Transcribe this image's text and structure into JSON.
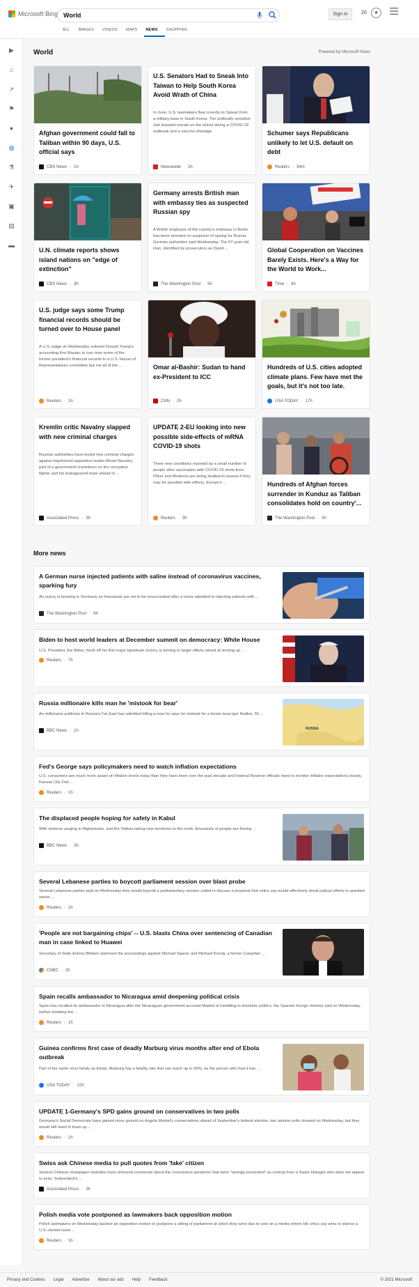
{
  "header": {
    "logo_text": "Microsoft Bing",
    "search_value": "World",
    "sign_in": "Sign in",
    "rewards_count": "20",
    "tabs": [
      {
        "label": "ALL"
      },
      {
        "label": "IMAGES"
      },
      {
        "label": "VIDEOS"
      },
      {
        "label": "MAPS"
      },
      {
        "label": "NEWS"
      },
      {
        "label": "SHOPPING"
      }
    ]
  },
  "icons": {
    "search": "search-icon",
    "mic": "microphone-icon",
    "menu": "hamburger-menu-icon",
    "rewards": "rewards-medal-icon"
  },
  "colors": {
    "accent": "#0066b4",
    "link_blue": "#2870c9",
    "background": "#f7f7f7"
  },
  "section": {
    "title": "World",
    "powered_by": "Powered by Microsoft News",
    "more_news_title": "More news"
  },
  "cards": [
    {
      "title": "Afghan government could fall to Taliban within 90 days, U.S. official says",
      "snippet": "",
      "source": "CBS News",
      "time": "1h",
      "has_image": true
    },
    {
      "title": "U.S. Senators Had to Sneak Into Taiwan to Help South Korea Avoid Wrath of China",
      "snippet": "In June, U.S. lawmakers flew covertly to Taiwan from a military base in South Korea. The politically sensitive visit boosted morale on the island during a COVID-19 outbreak and a vaccine shortage.",
      "source": "Newsweek",
      "time": "1h",
      "has_image": false
    },
    {
      "title": "Schumer says Republicans unlikely to let U.S. default on debt",
      "snippet": "",
      "source": "Reuters",
      "time": "34m",
      "has_image": true
    },
    {
      "title": "U.N. climate reports shows island nations on \"edge of extinction\"",
      "snippet": "",
      "source": "CBS News",
      "time": "3h",
      "has_image": true
    },
    {
      "title": "Germany arrests British man with embassy ties as suspected Russian spy",
      "snippet": "A British employee of the country's embassy in Berlin has been arrested on suspicion of spying for Russia, German authorities said Wednesday. The 57-year-old man, identified by prosecutors as David ...",
      "source": "The Washington Post",
      "time": "5h",
      "has_image": false
    },
    {
      "title": "Global Cooperation on Vaccines Barely Exists. Here's a Way for the World to Work...",
      "snippet": "",
      "source": "Time",
      "time": "6h",
      "has_image": true
    },
    {
      "title": "U.S. judge says some Trump financial records should be turned over to House panel",
      "snippet": "A U.S. judge on Wednesday ordered Donald Trump's accounting firm Mazars to turn over some of the former president's financial records to a U.S. House of Representatives committee but not all of the ...",
      "source": "Reuters",
      "time": "1h",
      "has_image": false
    },
    {
      "title": "Omar al-Bashir: Sudan to hand ex-President to ICC",
      "snippet": "",
      "source": "CNN",
      "time": "2h",
      "has_image": true
    },
    {
      "title": "Hundreds of U.S. cities adopted climate plans. Few have met the goals, but it's not too late.",
      "snippet": "",
      "source": "USA TODAY",
      "time": "17h",
      "has_image": true
    },
    {
      "title": "Kremlin critic Navalny slapped with new criminal charges",
      "snippet": "Russian authorities have levied new criminal charges against imprisoned opposition leader Alexei Navalny, part of a government crackdown on the corruption fighter and his beleaguered team ahead of ...",
      "source": "Associated Press",
      "time": "3h",
      "has_image": false
    },
    {
      "title": "UPDATE 2-EU looking into new possible side-effects of mRNA COVID-19 shots",
      "snippet": "Three new conditions reported by a small number of people after vaccination with COVID-19 shots from Pfizer and Moderna are being studied to assess if they may be possible side-effects, Europe's ...",
      "source": "Reuters",
      "time": "3h",
      "has_image": false
    },
    {
      "title": "Hundreds of Afghan forces surrender in Kunduz as Taliban consolidates hold on country'...",
      "snippet": "",
      "source": "The Washington Post",
      "time": "3h",
      "has_image": true
    }
  ],
  "more_news": [
    {
      "title": "A German nurse injected patients with saline instead of coronavirus vaccines, sparking fury",
      "snippet": "An outcry is brewing in Germany as thousands are set to be revaccinated after a nurse admitted to injecting patients with ...",
      "source": "The Washington Post",
      "time": "6h",
      "has_image": true
    },
    {
      "title": "Biden to host world leaders at December summit on democracy: White House",
      "snippet": "U.S. President Joe Biden, fresh off his first major bipartisan victory, is turning to larger efforts aimed at shoring up ...",
      "source": "Reuters",
      "time": "7h",
      "has_image": true
    },
    {
      "title": "Russia millionaire kills man he 'mistook for bear'",
      "snippet": "An millionaire politician in Russia's Far East has admitted killing a man he says he mistook for a brown bear.Igor Redkin, 55 ...",
      "source": "BBC News",
      "time": "1h",
      "has_image": true,
      "map_label": "RUSSIA"
    },
    {
      "title": "Fed's George says policymakers need to watch inflation expectations",
      "snippet": "U.S. consumers are much more aware of inflation levels today than they have been over the past decade and Federal Reserve officials need to monitor inflation expectations closely, Kansas City Fed ...",
      "source": "Reuters",
      "time": "1h",
      "has_image": false
    },
    {
      "title": "The displaced people hoping for safety in Kabul",
      "snippet": "With violence surging in Afghanistan, and the Taliban taking new territories in the north, thousands of people are fleeing ...",
      "source": "BBC News",
      "time": "2h",
      "has_image": true
    },
    {
      "title": "Several Lebanese parties to boycott parliament session over blast probe",
      "snippet": "Several Lebanese parties said on Wednesday they would boycott a parliamentary session called to discuss a proposal that critics say would effectively derail judicial efforts to question senior ...",
      "source": "Reuters",
      "time": "1h",
      "has_image": false
    },
    {
      "title": "'People are not bargaining chips' -- U.S. blasts China over sentencing of Canadian man in case linked to Huawei",
      "snippet": "Secretary of State Antony Blinken slammed the proceedings against Michael Spavor and Michael Kovrig, a former Canadian ...",
      "source": "CNBC",
      "time": "2h",
      "has_image": true
    },
    {
      "title": "Spain recalls ambassador to Nicaragua amid deepening political crisis",
      "snippet": "Spain has recalled its ambassador to Nicaragua after the Nicaraguan government accused Madrid of meddling in domestic politics, the Spanish foreign ministry said on Wednesday, further isolating the ...",
      "source": "Reuters",
      "time": "1h",
      "has_image": false
    },
    {
      "title": "Guinea confirms first case of deadly Marburg virus months after end of Ebola outbreak",
      "snippet": "Part of the same virus family as Ebola, Marburg has a fatality rate that can reach up to 90%, as the person who had it has ...",
      "source": "USA TODAY",
      "time": "22h",
      "has_image": true
    },
    {
      "title": "UPDATE 1-Germany's SPD gains ground on conservatives in two polls",
      "snippet": "Germany's Social Democrats have gained more ground on Angela Merkel's conservatives ahead of September's federal election, two opinion polls showed on Wednesday, but they would still need to team up ...",
      "source": "Reuters",
      "time": "1h",
      "has_image": false
    },
    {
      "title": "Swiss ask Chinese media to pull quotes from 'fake' citizen",
      "snippet": "Several Chinese newspaper websites have removed comments about the coronavirus pandemic that were \"wrongly presented\" as coming from a Swiss biologist who does not appear to exist, Switzerland's ...",
      "source": "Associated Press",
      "time": "3h",
      "has_image": false
    },
    {
      "title": "Polish media vote postponed as lawmakers back opposition motion",
      "snippet": "Polish lawmakers on Wednesday backed an opposition motion to postpone a sitting of parliament at which they were due to vote on a media reform bill critics say aims to silence a U.S.-owned news ...",
      "source": "Reuters",
      "time": "1h",
      "has_image": false
    }
  ],
  "footer": {
    "links": [
      "Privacy and Cookies",
      "Legal",
      "Advertise",
      "About our ads",
      "Help",
      "Feedback"
    ],
    "copyright": "© 2021 Microsoft"
  }
}
